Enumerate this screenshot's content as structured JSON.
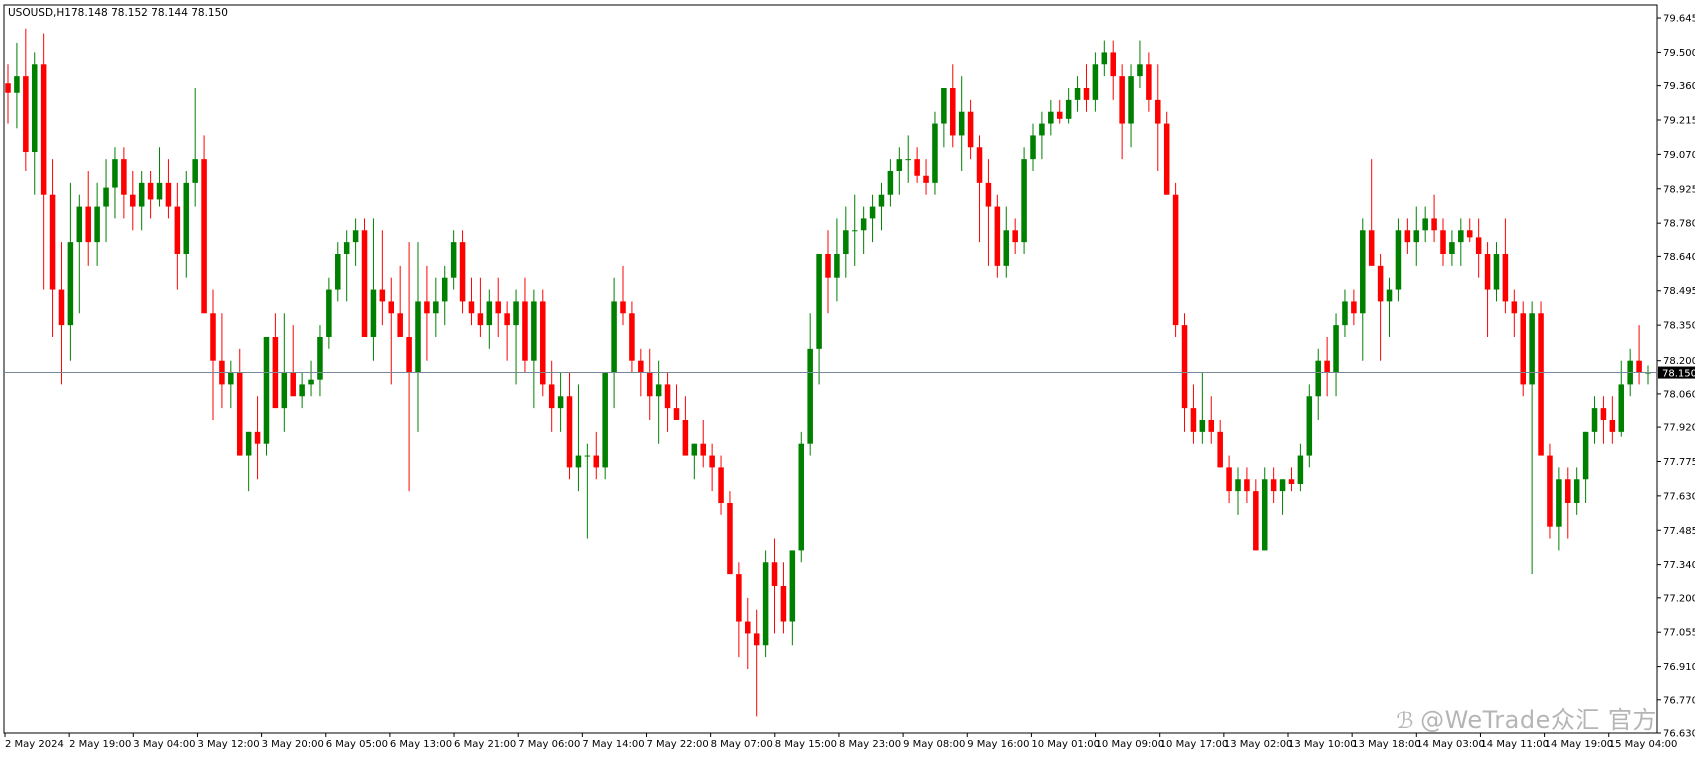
{
  "header": {
    "symbol": "USOUSD,H1",
    "ohlc": "78.148 78.152 78.144 78.150"
  },
  "watermark": {
    "icon": "wetrade-logo-icon",
    "text": "@WeTrade众汇 官方"
  },
  "colors": {
    "bull": "#008000",
    "bear": "#ff0000",
    "price_line": "#778899",
    "price_tag_bg": "#000000",
    "price_tag_text": "#ffffff",
    "axis": "#000000"
  },
  "chart_data": {
    "type": "candlestick",
    "symbol": "USOUSD",
    "timeframe": "H1",
    "ylim": [
      76.63,
      79.7
    ],
    "y_ticks": [
      "79.645",
      "79.500",
      "79.360",
      "79.215",
      "79.070",
      "78.925",
      "78.780",
      "78.640",
      "78.495",
      "78.350",
      "78.200",
      "78.060",
      "77.920",
      "77.775",
      "77.630",
      "77.485",
      "77.340",
      "77.200",
      "77.055",
      "76.910",
      "76.770",
      "76.630"
    ],
    "x_ticks": [
      "2 May 2024",
      "2 May 19:00",
      "3 May 04:00",
      "3 May 12:00",
      "3 May 20:00",
      "6 May 05:00",
      "6 May 13:00",
      "6 May 21:00",
      "7 May 06:00",
      "7 May 14:00",
      "7 May 22:00",
      "8 May 07:00",
      "8 May 15:00",
      "8 May 23:00",
      "9 May 08:00",
      "9 May 16:00",
      "10 May 01:00",
      "10 May 09:00",
      "10 May 17:00",
      "13 May 02:00",
      "13 May 10:00",
      "13 May 18:00",
      "14 May 03:00",
      "14 May 11:00",
      "14 May 19:00",
      "15 May 04:00"
    ],
    "current_price": "78.150",
    "candles": [
      [
        79.37,
        79.45,
        79.2,
        79.33
      ],
      [
        79.33,
        79.54,
        79.18,
        79.4
      ],
      [
        79.4,
        79.6,
        79.0,
        79.08
      ],
      [
        79.08,
        79.5,
        78.9,
        79.45
      ],
      [
        79.45,
        79.58,
        78.5,
        78.9
      ],
      [
        78.9,
        79.05,
        78.3,
        78.5
      ],
      [
        78.5,
        78.7,
        78.1,
        78.35
      ],
      [
        78.35,
        78.95,
        78.2,
        78.7
      ],
      [
        78.7,
        78.9,
        78.4,
        78.85
      ],
      [
        78.85,
        79.0,
        78.6,
        78.7
      ],
      [
        78.7,
        78.95,
        78.6,
        78.85
      ],
      [
        78.85,
        79.05,
        78.7,
        78.93
      ],
      [
        78.93,
        79.1,
        78.8,
        79.05
      ],
      [
        79.05,
        79.1,
        78.8,
        78.9
      ],
      [
        78.9,
        79.0,
        78.75,
        78.85
      ],
      [
        78.85,
        79.0,
        78.75,
        78.95
      ],
      [
        78.95,
        79.0,
        78.8,
        78.88
      ],
      [
        78.88,
        79.1,
        78.85,
        78.95
      ],
      [
        78.95,
        79.05,
        78.8,
        78.85
      ],
      [
        78.85,
        78.95,
        78.5,
        78.65
      ],
      [
        78.65,
        79.0,
        78.55,
        78.95
      ],
      [
        78.95,
        79.35,
        78.85,
        79.05
      ],
      [
        79.05,
        79.15,
        78.65,
        78.4
      ],
      [
        78.4,
        78.5,
        77.95,
        78.2
      ],
      [
        78.2,
        78.4,
        78.0,
        78.1
      ],
      [
        78.1,
        78.2,
        78.0,
        78.15
      ],
      [
        78.15,
        78.25,
        77.8,
        77.8
      ],
      [
        77.8,
        77.9,
        77.65,
        77.9
      ],
      [
        77.9,
        78.05,
        77.7,
        77.85
      ],
      [
        77.85,
        78.3,
        77.8,
        78.3
      ],
      [
        78.3,
        78.4,
        78.1,
        78.0
      ],
      [
        78.0,
        78.4,
        77.9,
        78.15
      ],
      [
        78.15,
        78.35,
        78.1,
        78.05
      ],
      [
        78.05,
        78.15,
        78.0,
        78.1
      ],
      [
        78.1,
        78.2,
        78.05,
        78.12
      ],
      [
        78.12,
        78.35,
        78.05,
        78.3
      ],
      [
        78.3,
        78.55,
        78.25,
        78.5
      ],
      [
        78.5,
        78.7,
        78.45,
        78.65
      ],
      [
        78.65,
        78.75,
        78.45,
        78.7
      ],
      [
        78.7,
        78.8,
        78.6,
        78.75
      ],
      [
        78.75,
        78.8,
        78.35,
        78.3
      ],
      [
        78.3,
        78.8,
        78.2,
        78.5
      ],
      [
        78.5,
        78.75,
        78.35,
        78.45
      ],
      [
        78.45,
        78.55,
        78.1,
        78.4
      ],
      [
        78.4,
        78.6,
        78.3,
        78.3
      ],
      [
        78.3,
        78.7,
        77.65,
        78.15
      ],
      [
        78.15,
        78.7,
        77.9,
        78.45
      ],
      [
        78.45,
        78.6,
        78.2,
        78.4
      ],
      [
        78.4,
        78.55,
        78.3,
        78.45
      ],
      [
        78.45,
        78.6,
        78.35,
        78.55
      ],
      [
        78.55,
        78.75,
        78.5,
        78.7
      ],
      [
        78.7,
        78.75,
        78.4,
        78.45
      ],
      [
        78.45,
        78.55,
        78.35,
        78.4
      ],
      [
        78.4,
        78.55,
        78.3,
        78.35
      ],
      [
        78.35,
        78.5,
        78.25,
        78.45
      ],
      [
        78.45,
        78.55,
        78.3,
        78.4
      ],
      [
        78.4,
        78.45,
        78.2,
        78.35
      ],
      [
        78.35,
        78.5,
        78.1,
        78.45
      ],
      [
        78.45,
        78.55,
        78.15,
        78.2
      ],
      [
        78.2,
        78.5,
        78.0,
        78.45
      ],
      [
        78.45,
        78.5,
        78.05,
        78.1
      ],
      [
        78.1,
        78.2,
        77.9,
        78.0
      ],
      [
        78.0,
        78.15,
        77.9,
        78.05
      ],
      [
        78.05,
        78.15,
        77.7,
        77.75
      ],
      [
        77.75,
        78.1,
        77.65,
        77.8
      ],
      [
        77.8,
        77.85,
        77.45,
        77.8
      ],
      [
        77.8,
        77.9,
        77.7,
        77.75
      ],
      [
        77.75,
        78.15,
        77.7,
        78.15
      ],
      [
        78.15,
        78.55,
        78.0,
        78.45
      ],
      [
        78.45,
        78.6,
        78.35,
        78.4
      ],
      [
        78.4,
        78.45,
        78.15,
        78.2
      ],
      [
        78.2,
        78.25,
        78.05,
        78.15
      ],
      [
        78.15,
        78.25,
        77.95,
        78.05
      ],
      [
        78.05,
        78.2,
        77.85,
        78.1
      ],
      [
        78.1,
        78.15,
        77.9,
        78.0
      ],
      [
        78.0,
        78.1,
        77.95,
        77.95
      ],
      [
        77.95,
        78.05,
        77.8,
        77.8
      ],
      [
        77.8,
        77.85,
        77.7,
        77.85
      ],
      [
        77.85,
        77.95,
        77.75,
        77.8
      ],
      [
        77.8,
        77.85,
        77.65,
        77.75
      ],
      [
        77.75,
        77.8,
        77.55,
        77.6
      ],
      [
        77.6,
        77.65,
        77.45,
        77.3
      ],
      [
        77.3,
        77.35,
        76.95,
        77.1
      ],
      [
        77.1,
        77.2,
        76.9,
        77.05
      ],
      [
        77.05,
        77.15,
        76.7,
        77.0
      ],
      [
        77.0,
        77.4,
        76.95,
        77.35
      ],
      [
        77.35,
        77.45,
        77.05,
        77.25
      ],
      [
        77.25,
        77.35,
        77.05,
        77.1
      ],
      [
        77.1,
        77.3,
        77.0,
        77.4
      ],
      [
        77.4,
        77.9,
        77.35,
        77.85
      ],
      [
        77.85,
        78.4,
        77.8,
        78.25
      ],
      [
        78.25,
        78.6,
        78.1,
        78.65
      ],
      [
        78.65,
        78.75,
        78.4,
        78.55
      ],
      [
        78.55,
        78.8,
        78.45,
        78.65
      ],
      [
        78.65,
        78.85,
        78.55,
        78.75
      ],
      [
        78.75,
        78.9,
        78.6,
        78.75
      ],
      [
        78.75,
        78.85,
        78.65,
        78.8
      ],
      [
        78.8,
        78.9,
        78.7,
        78.85
      ],
      [
        78.85,
        78.95,
        78.75,
        78.9
      ],
      [
        78.9,
        79.05,
        78.85,
        79.0
      ],
      [
        79.0,
        79.1,
        78.9,
        79.05
      ],
      [
        79.05,
        79.15,
        78.95,
        79.05
      ],
      [
        79.05,
        79.1,
        78.95,
        78.98
      ],
      [
        78.98,
        79.05,
        78.9,
        78.95
      ],
      [
        78.95,
        79.25,
        78.9,
        79.2
      ],
      [
        79.2,
        79.35,
        79.1,
        79.35
      ],
      [
        79.35,
        79.45,
        79.1,
        79.15
      ],
      [
        79.15,
        79.4,
        79.0,
        79.25
      ],
      [
        79.25,
        79.3,
        79.05,
        79.1
      ],
      [
        79.1,
        79.15,
        78.7,
        78.95
      ],
      [
        78.95,
        79.05,
        78.6,
        78.85
      ],
      [
        78.85,
        78.9,
        78.55,
        78.6
      ],
      [
        78.6,
        78.85,
        78.55,
        78.75
      ],
      [
        78.75,
        78.8,
        78.65,
        78.7
      ],
      [
        78.7,
        79.1,
        78.65,
        79.05
      ],
      [
        79.05,
        79.2,
        79.0,
        79.15
      ],
      [
        79.15,
        79.25,
        79.05,
        79.2
      ],
      [
        79.2,
        79.3,
        79.15,
        79.25
      ],
      [
        79.25,
        79.3,
        79.2,
        79.22
      ],
      [
        79.22,
        79.35,
        79.2,
        79.3
      ],
      [
        79.3,
        79.4,
        79.25,
        79.35
      ],
      [
        79.35,
        79.45,
        79.25,
        79.3
      ],
      [
        79.3,
        79.5,
        79.25,
        79.45
      ],
      [
        79.45,
        79.55,
        79.4,
        79.5
      ],
      [
        79.5,
        79.55,
        79.3,
        79.4
      ],
      [
        79.4,
        79.45,
        79.05,
        79.2
      ],
      [
        79.2,
        79.45,
        79.1,
        79.4
      ],
      [
        79.4,
        79.55,
        79.35,
        79.45
      ],
      [
        79.45,
        79.5,
        79.25,
        79.3
      ],
      [
        79.3,
        79.45,
        79.0,
        79.2
      ],
      [
        79.2,
        79.25,
        78.9,
        78.9
      ],
      [
        78.9,
        78.95,
        78.3,
        78.35
      ],
      [
        78.35,
        78.4,
        77.9,
        78.0
      ],
      [
        78.0,
        78.1,
        77.85,
        77.9
      ],
      [
        77.9,
        78.15,
        77.85,
        77.95
      ],
      [
        77.95,
        78.05,
        77.85,
        77.9
      ],
      [
        77.9,
        77.95,
        77.75,
        77.75
      ],
      [
        77.75,
        77.8,
        77.6,
        77.65
      ],
      [
        77.65,
        77.75,
        77.55,
        77.7
      ],
      [
        77.7,
        77.75,
        77.6,
        77.65
      ],
      [
        77.65,
        77.7,
        77.4,
        77.4
      ],
      [
        77.4,
        77.75,
        77.4,
        77.7
      ],
      [
        77.7,
        77.75,
        77.6,
        77.65
      ],
      [
        77.65,
        77.7,
        77.55,
        77.7
      ],
      [
        77.7,
        77.75,
        77.65,
        77.68
      ],
      [
        77.68,
        77.85,
        77.65,
        77.8
      ],
      [
        77.8,
        78.1,
        77.75,
        78.05
      ],
      [
        78.05,
        78.25,
        77.95,
        78.2
      ],
      [
        78.2,
        78.3,
        78.05,
        78.15
      ],
      [
        78.15,
        78.4,
        78.05,
        78.35
      ],
      [
        78.35,
        78.5,
        78.3,
        78.45
      ],
      [
        78.45,
        78.5,
        78.35,
        78.4
      ],
      [
        78.4,
        78.8,
        78.2,
        78.75
      ],
      [
        78.75,
        79.05,
        78.65,
        78.6
      ],
      [
        78.6,
        78.65,
        78.2,
        78.45
      ],
      [
        78.45,
        78.55,
        78.3,
        78.5
      ],
      [
        78.5,
        78.8,
        78.45,
        78.75
      ],
      [
        78.75,
        78.8,
        78.65,
        78.7
      ],
      [
        78.7,
        78.85,
        78.6,
        78.75
      ],
      [
        78.75,
        78.85,
        78.7,
        78.8
      ],
      [
        78.8,
        78.9,
        78.7,
        78.75
      ],
      [
        78.75,
        78.8,
        78.6,
        78.65
      ],
      [
        78.65,
        78.75,
        78.6,
        78.7
      ],
      [
        78.7,
        78.8,
        78.6,
        78.75
      ],
      [
        78.75,
        78.8,
        78.7,
        78.72
      ],
      [
        78.72,
        78.8,
        78.55,
        78.65
      ],
      [
        78.65,
        78.7,
        78.3,
        78.5
      ],
      [
        78.5,
        78.7,
        78.45,
        78.65
      ],
      [
        78.65,
        78.8,
        78.4,
        78.45
      ],
      [
        78.45,
        78.5,
        78.3,
        78.4
      ],
      [
        78.4,
        78.45,
        78.05,
        78.1
      ],
      [
        78.1,
        78.45,
        77.3,
        78.4
      ],
      [
        78.4,
        78.45,
        77.8,
        77.8
      ],
      [
        77.8,
        77.85,
        77.45,
        77.5
      ],
      [
        77.5,
        77.75,
        77.4,
        77.7
      ],
      [
        77.7,
        77.75,
        77.45,
        77.6
      ],
      [
        77.6,
        77.75,
        77.55,
        77.7
      ],
      [
        77.7,
        77.9,
        77.6,
        77.9
      ],
      [
        77.9,
        78.05,
        77.85,
        78.0
      ],
      [
        78.0,
        78.05,
        77.85,
        77.95
      ],
      [
        77.95,
        78.05,
        77.85,
        77.9
      ],
      [
        77.9,
        78.2,
        77.88,
        78.1
      ],
      [
        78.1,
        78.25,
        78.05,
        78.2
      ],
      [
        78.2,
        78.35,
        78.1,
        78.15
      ],
      [
        78.15,
        78.18,
        78.1,
        78.15
      ]
    ]
  }
}
